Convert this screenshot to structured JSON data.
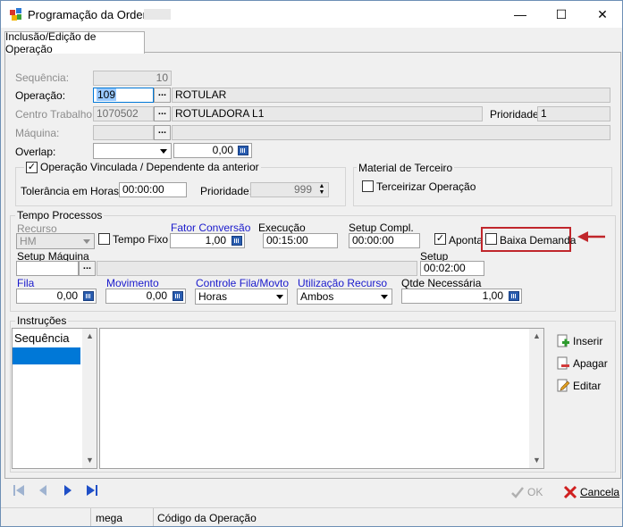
{
  "window": {
    "title": "Programação da Ordem",
    "minimize": "—",
    "maximize": "☐",
    "close": "✕"
  },
  "tab": {
    "label": "Inclusão/Edição de Operação"
  },
  "form": {
    "sequencia_label": "Sequência:",
    "sequencia_value": "10",
    "operacao_label": "Operação:",
    "operacao_code": "109",
    "operacao_desc": "ROTULAR",
    "centro_label": "Centro Trabalho:",
    "centro_code": "1070502",
    "centro_desc": "ROTULADORA L1",
    "prioridade_label": "Prioridade:",
    "prioridade_value": "1",
    "maquina_label": "Máquina:",
    "maquina_code": "",
    "maquina_desc": "",
    "overlap_label": "Overlap:",
    "overlap_select": "",
    "overlap_value": "0,00",
    "ellipsis": "..."
  },
  "vinculada": {
    "label": "Operação Vinculada / Dependente da anterior",
    "checked": true,
    "tolerancia_label": "Tolerância em Horas:",
    "tolerancia_value": "00:00:00",
    "prioridade_label": "Prioridade:",
    "prioridade_value": "999"
  },
  "terceiro": {
    "title": "Material de Terceiro",
    "terceirizar_label": "Terceirizar Operação",
    "checked": false
  },
  "tempo": {
    "title": "Tempo Processos",
    "recurso_label": "Recurso",
    "recurso_value": "HM",
    "tempo_fixo_label": "Tempo Fixo",
    "tempo_fixo_checked": false,
    "fator_label": "Fator Conversão",
    "fator_value": "1,00",
    "execucao_label": "Execução",
    "execucao_value": "00:15:00",
    "setup_compl_label": "Setup Compl.",
    "setup_compl_value": "00:00:00",
    "aponta_label": "Aponta",
    "aponta_checked": true,
    "baixa_label": "Baixa Demanda",
    "baixa_checked": false,
    "setup_maquina_label": "Setup Máquina",
    "setup_maquina_value": "",
    "setup_label": "Setup",
    "setup_value": "00:02:00",
    "fila_label": "Fila",
    "fila_value": "0,00",
    "movimento_label": "Movimento",
    "movimento_value": "0,00",
    "controle_label": "Controle Fila/Movto",
    "controle_value": "Horas",
    "utilizacao_label": "Utilização Recurso",
    "utilizacao_value": "Ambos",
    "qtde_label": "Qtde Necessária",
    "qtde_value": "1,00"
  },
  "instrucoes": {
    "title": "Instruções",
    "column_header": "Sequência",
    "inserir": "Inserir",
    "apagar": "Apagar",
    "editar": "Editar"
  },
  "footer": {
    "ok": "OK",
    "cancela": "Cancela"
  },
  "status": {
    "field1": "mega",
    "field2": "Código da Operação"
  },
  "colors": {
    "accent_red": "#c0262b",
    "selection_blue": "#0078d7"
  }
}
